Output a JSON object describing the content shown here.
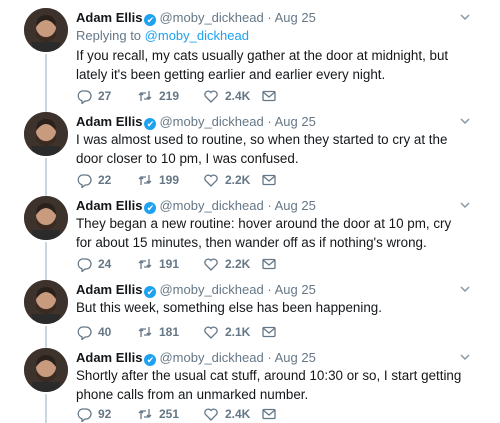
{
  "tweets": [
    {
      "name": "Adam Ellis",
      "verified": "✔",
      "handle": "@moby_dickhead",
      "dot": "·",
      "date": "Aug 25",
      "replying_label": "Replying to",
      "replying_to": "@moby_dickhead",
      "text": "If you recall, my cats usually gather at the door at midnight, but lately it's been getting earlier and earlier every night.",
      "replies": "27",
      "retweets": "219",
      "likes": "2.4K"
    },
    {
      "name": "Adam Ellis",
      "verified": "✔",
      "handle": "@moby_dickhead",
      "dot": "·",
      "date": "Aug 25",
      "text": "I was almost used to routine, so when they started to cry at the door closer to 10 pm, I was confused.",
      "replies": "22",
      "retweets": "199",
      "likes": "2.2K"
    },
    {
      "name": "Adam Ellis",
      "verified": "✔",
      "handle": "@moby_dickhead",
      "dot": "·",
      "date": "Aug 25",
      "text": "They began a new routine: hover around the door at 10 pm, cry for about 15 minutes, then wander off as if nothing's wrong.",
      "replies": "24",
      "retweets": "191",
      "likes": "2.2K"
    },
    {
      "name": "Adam Ellis",
      "verified": "✔",
      "handle": "@moby_dickhead",
      "dot": "·",
      "date": "Aug 25",
      "text": "But this week, something else has been happening.",
      "replies": "40",
      "retweets": "181",
      "likes": "2.1K"
    },
    {
      "name": "Adam Ellis",
      "verified": "✔",
      "handle": "@moby_dickhead",
      "dot": "·",
      "date": "Aug 25",
      "text": "Shortly after the usual cat stuff, around 10:30 or so, I start getting phone calls from an unmarked number.",
      "replies": "92",
      "retweets": "251",
      "likes": "2.4K"
    }
  ],
  "icons": {
    "reply": "reply-icon",
    "retweet": "retweet-icon",
    "like": "heart-icon",
    "message": "envelope-icon",
    "menu": "chevron-down-icon"
  },
  "colors": {
    "accent": "#1da1f2",
    "muted": "#657786",
    "text": "#14171a",
    "rail": "#ccd6dd"
  }
}
